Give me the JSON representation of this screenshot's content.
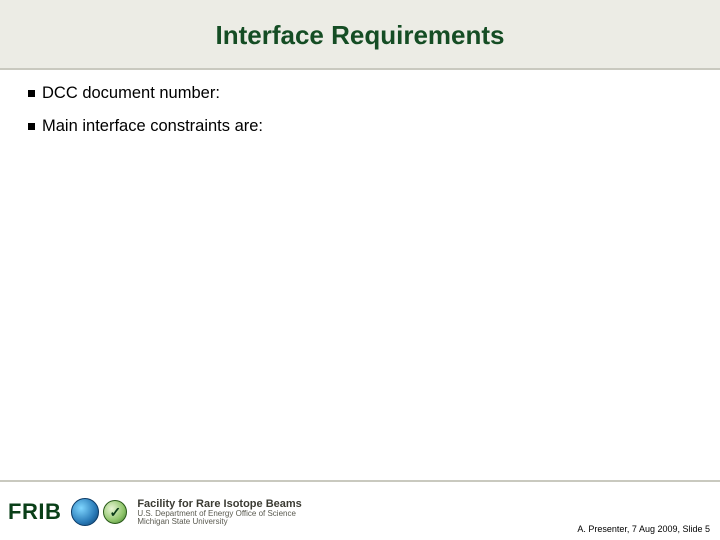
{
  "title": "Interface Requirements",
  "bullets": [
    "DCC document number:",
    "Main interface constraints are:"
  ],
  "footer": {
    "frib": "FRIB",
    "org_main": "Facility for Rare Isotope Beams",
    "org_sub1": "U.S. Department of Energy Office of Science",
    "org_sub2": "Michigan State University",
    "meta": "A. Presenter, 7 Aug 2009, Slide 5"
  }
}
